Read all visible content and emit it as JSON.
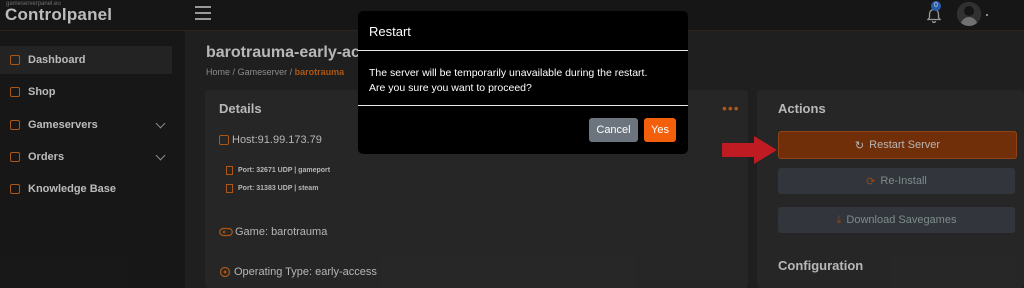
{
  "header": {
    "logo_small": "gameserverpanel.eu",
    "logo": "Controlpanel",
    "notification_count": "0"
  },
  "sidebar": {
    "items": [
      {
        "label": "Dashboard",
        "icon": "dashboard-icon"
      },
      {
        "label": "Shop",
        "icon": "shop-icon"
      },
      {
        "label": "Gameservers",
        "icon": "gameservers-icon"
      },
      {
        "label": "Orders",
        "icon": "orders-icon"
      },
      {
        "label": "Knowledge Base",
        "icon": "book-icon"
      }
    ]
  },
  "page": {
    "title": "barotrauma-early-acce",
    "breadcrumb": {
      "home": "Home",
      "sep1": "/",
      "gameserver": "Gameserver",
      "sep2": "/",
      "current": "barotrauma"
    }
  },
  "details": {
    "title": "Details",
    "host": "Host:91.99.173.79",
    "port1": "Port: 32671 UDP | gameport",
    "port2": "Port: 31383 UDP | steam",
    "game": "Game: barotrauma",
    "operating_type": "Operating Type: early-access"
  },
  "actions": {
    "title": "Actions",
    "restart": "Restart Server",
    "reinstall": "Re-Install",
    "download": "Download Savegames",
    "configuration": "Configuration"
  },
  "modal": {
    "title": "Restart",
    "line1": "The server will be temporarily unavailable during the restart.",
    "line2": "Are you sure you want to proceed?",
    "cancel": "Cancel",
    "yes": "Yes"
  },
  "colors": {
    "accent": "#d4691c",
    "yes_button": "#f35f0a",
    "cancel_button": "#6c757d",
    "arrow": "#e8222a"
  }
}
